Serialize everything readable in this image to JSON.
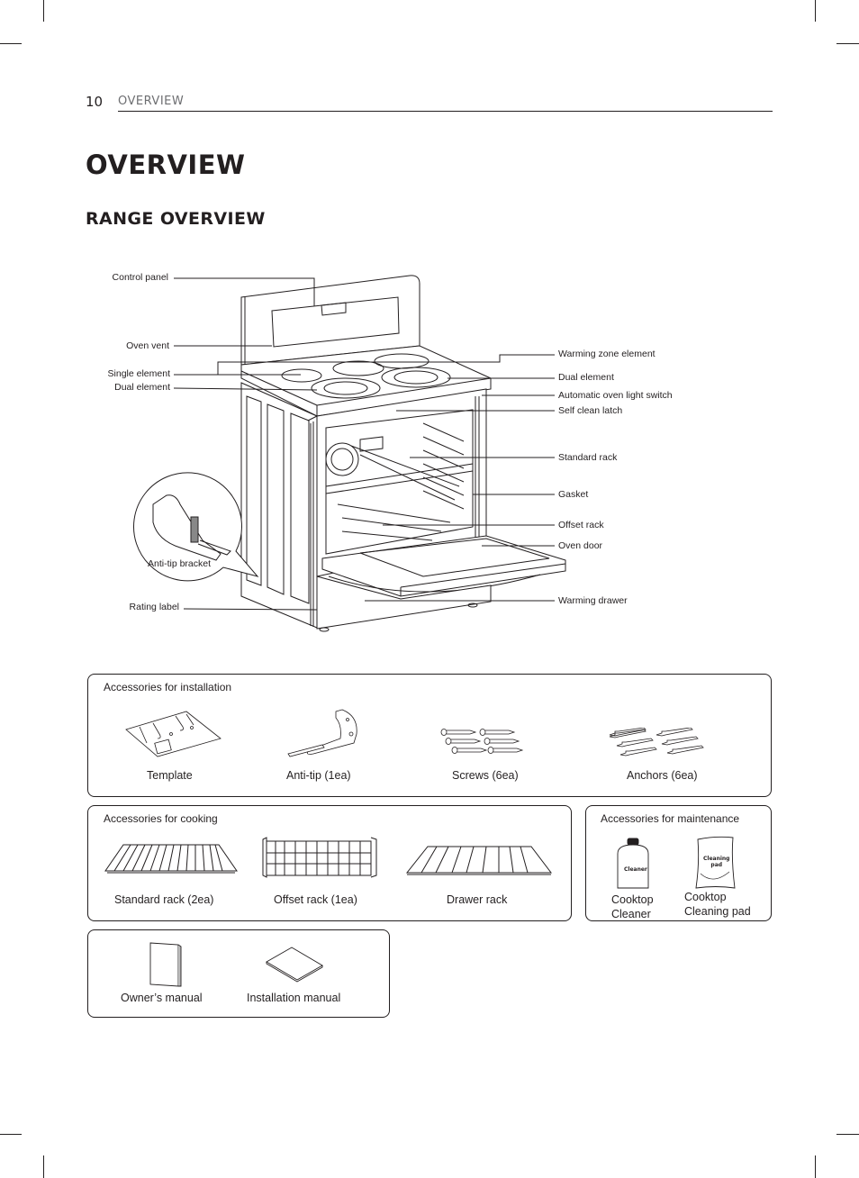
{
  "header": {
    "page_number": "10",
    "section": "OVERVIEW"
  },
  "title": "OVERVIEW",
  "subtitle": "RANGE OVERVIEW",
  "diagram": {
    "left_labels": [
      {
        "id": "control-panel",
        "text": "Control panel"
      },
      {
        "id": "oven-vent",
        "text": "Oven vent"
      },
      {
        "id": "single-element",
        "text": "Single element"
      },
      {
        "id": "dual-element-left",
        "text": "Dual element"
      },
      {
        "id": "anti-tip-bracket",
        "text": "Anti-tip bracket"
      },
      {
        "id": "rating-label",
        "text": "Rating label"
      }
    ],
    "right_labels": [
      {
        "id": "warming-zone-element",
        "text": "Warming zone element"
      },
      {
        "id": "dual-element-right",
        "text": "Dual element"
      },
      {
        "id": "automatic-oven-light-switch",
        "text": "Automatic oven light switch"
      },
      {
        "id": "self-clean-latch",
        "text": "Self clean latch"
      },
      {
        "id": "standard-rack",
        "text": "Standard rack"
      },
      {
        "id": "gasket",
        "text": "Gasket"
      },
      {
        "id": "offset-rack",
        "text": "Offset rack"
      },
      {
        "id": "oven-door",
        "text": "Oven door"
      },
      {
        "id": "warming-drawer",
        "text": "Warming drawer"
      }
    ]
  },
  "accessories": {
    "installation": {
      "title": "Accessories for installation",
      "items": [
        {
          "icon": "template-icon",
          "label": "Template"
        },
        {
          "icon": "anti-tip-icon",
          "label": "Anti-tip (1ea)"
        },
        {
          "icon": "screws-icon",
          "label": "Screws (6ea)"
        },
        {
          "icon": "anchors-icon",
          "label": "Anchors (6ea)"
        }
      ]
    },
    "cooking": {
      "title": "Accessories for cooking",
      "items": [
        {
          "icon": "standard-rack-icon",
          "label": "Standard rack (2ea)"
        },
        {
          "icon": "offset-rack-icon",
          "label": "Offset rack (1ea)"
        },
        {
          "icon": "drawer-rack-icon",
          "label": "Drawer rack"
        }
      ]
    },
    "maintenance": {
      "title": "Accessories for maintenance",
      "items": [
        {
          "icon": "cooktop-cleaner-icon",
          "label_line1": "Cooktop",
          "label_line2": "Cleaner",
          "bottle_text": "Cleaner"
        },
        {
          "icon": "cleaning-pad-icon",
          "label_line1": "Cooktop",
          "label_line2": "Cleaning pad",
          "pad_text_line1": "Cleaning",
          "pad_text_line2": "pad"
        }
      ]
    },
    "manuals": {
      "items": [
        {
          "icon": "owners-manual-icon",
          "label": "Owner’s manual"
        },
        {
          "icon": "installation-manual-icon",
          "label": "Installation manual"
        }
      ]
    }
  }
}
